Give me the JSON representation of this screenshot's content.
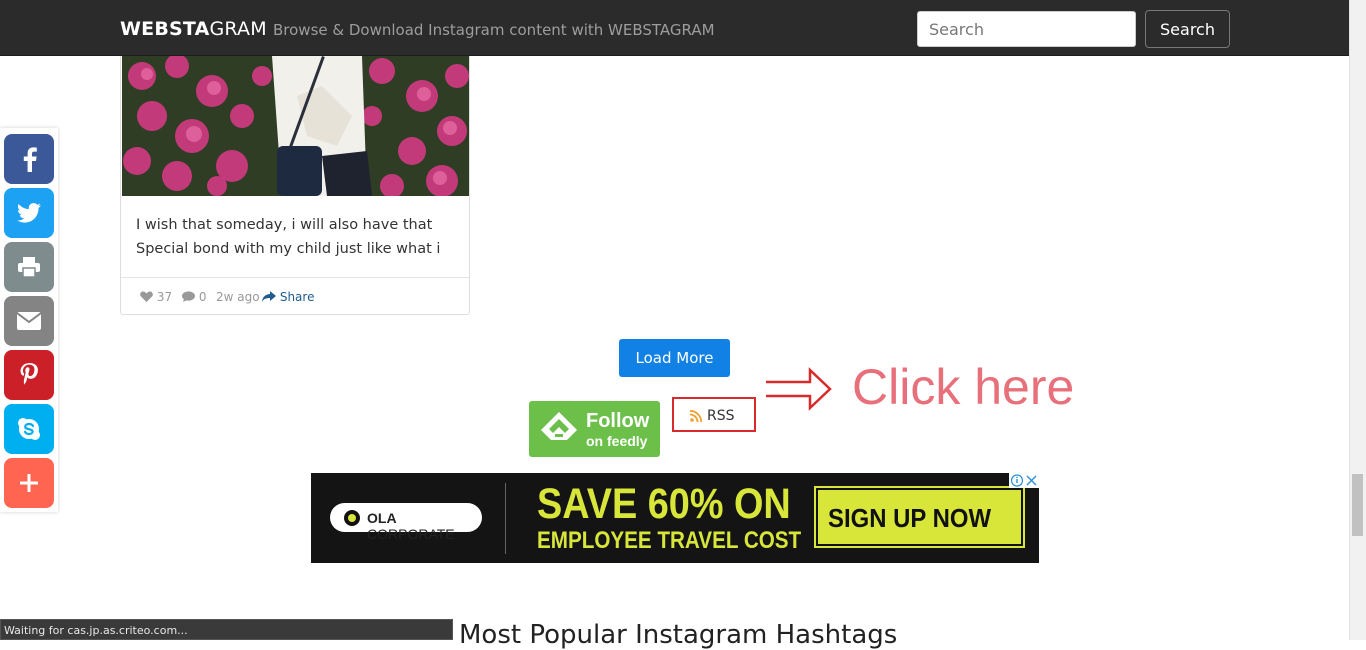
{
  "navbar": {
    "brand_bold": "WEBSTA",
    "brand_light": "GRAM",
    "tagline": "Browse & Download Instagram content with WEBSTAGRAM",
    "search_placeholder": "Search",
    "search_button": "Search"
  },
  "post": {
    "caption_line1": "I wish that someday, i will also have that",
    "caption_line2": "Special bond with my child just like what i",
    "likes": "37",
    "comments": "0",
    "age": "2w ago",
    "share_label": "Share"
  },
  "social_sidebar": {
    "buttons": [
      {
        "name": "facebook",
        "color": "#3b5998"
      },
      {
        "name": "twitter",
        "color": "#1da1f2"
      },
      {
        "name": "print",
        "color": "#7f8c8d"
      },
      {
        "name": "email",
        "color": "#848484"
      },
      {
        "name": "pinterest",
        "color": "#cb2027"
      },
      {
        "name": "skype",
        "color": "#00aff0"
      },
      {
        "name": "more",
        "color": "#ff6550"
      }
    ]
  },
  "actions": {
    "load_more": "Load More",
    "feedly_line1": "Follow",
    "feedly_line2": "on feedly",
    "rss_label": "RSS",
    "click_here": "Click here"
  },
  "ad": {
    "brand_bold": "OLA",
    "brand_rest": " CORPORATE",
    "headline": "SAVE 60% ON",
    "subline": "EMPLOYEE TRAVEL COST",
    "cta": "SIGN UP NOW"
  },
  "status_bar": {
    "text": "Waiting for cas.jp.as.criteo.com..."
  },
  "section": {
    "title": "Most Popular Instagram Hashtags"
  },
  "colors": {
    "navbar_bg": "#2b2b2b",
    "load_more_bg": "#1281e5",
    "feedly_green": "#6cc04a",
    "rss_border": "#d92b2b",
    "click_here_text": "#e8707a",
    "ad_yellow": "#d8e63a"
  }
}
